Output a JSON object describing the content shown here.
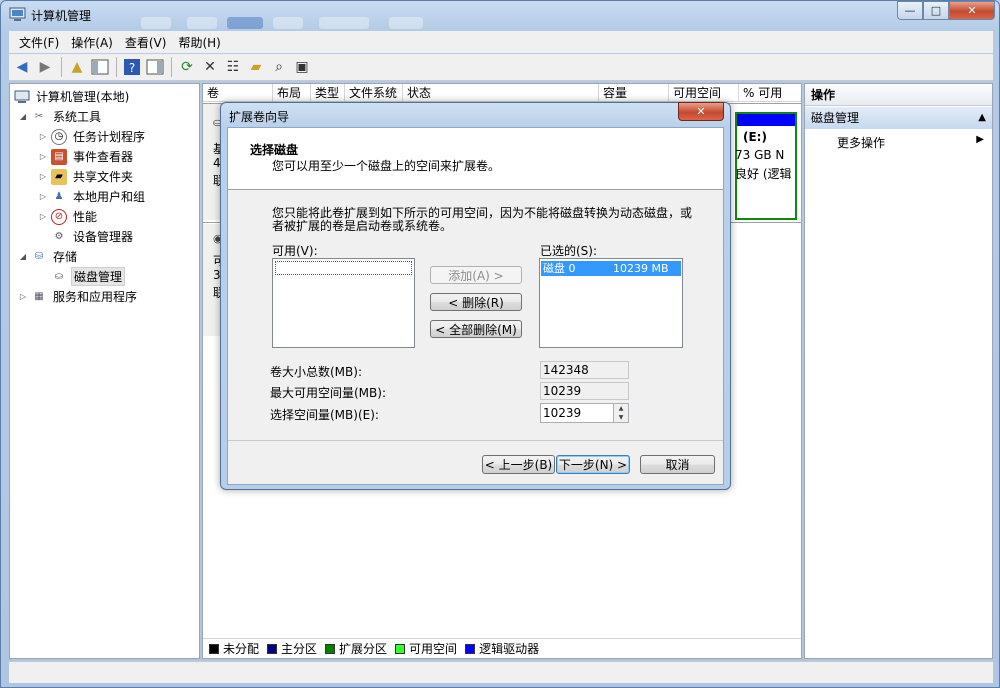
{
  "window": {
    "title": "计算机管理",
    "controls": {
      "minimize": "—",
      "maximize": "□",
      "close": "✕"
    }
  },
  "menu": [
    "文件(F)",
    "操作(A)",
    "查看(V)",
    "帮助(H)"
  ],
  "tree": {
    "root": "计算机管理(本地)",
    "system_tools": "系统工具",
    "task_scheduler": "任务计划程序",
    "event_viewer": "事件查看器",
    "shared_folders": "共享文件夹",
    "local_users": "本地用户和组",
    "performance": "性能",
    "device_manager": "设备管理器",
    "storage": "存储",
    "disk_management": "磁盘管理",
    "services": "服务和应用程序"
  },
  "columns": [
    "卷",
    "布局",
    "类型",
    "文件系统",
    "状态",
    "容量",
    "可用空间",
    "% 可用"
  ],
  "disk_view": {
    "disk0_lines": [
      "基",
      "4",
      "联"
    ],
    "disk1_lines": [
      "可",
      "3",
      "联"
    ],
    "partition_e": {
      "name": "(E:)",
      "size": "73 GB N",
      "status": "良好 (逻辑"
    }
  },
  "legend": [
    {
      "label": "未分配",
      "color": "#000000"
    },
    {
      "label": "主分区",
      "color": "#00007f"
    },
    {
      "label": "扩展分区",
      "color": "#007f00"
    },
    {
      "label": "可用空间",
      "color": "#33ff33"
    },
    {
      "label": "逻辑驱动器",
      "color": "#0000ff"
    }
  ],
  "actions": {
    "header": "操作",
    "section": "磁盘管理",
    "more": "更多操作"
  },
  "wizard": {
    "title": "扩展卷向导",
    "header_title": "选择磁盘",
    "header_subtitle": "您可以用至少一个磁盘上的空间来扩展卷。",
    "description_line1": "您只能将此卷扩展到如下所示的可用空间，因为不能将磁盘转换为动态磁盘，或",
    "description_line2": "者被扩展的卷是启动卷或系统卷。",
    "available_label": "可用(V):",
    "selected_label": "已选的(S):",
    "selected_item": {
      "disk": "磁盘 0",
      "size": "10239 MB"
    },
    "add_button": "添加(A) >",
    "remove_button": "< 删除(R)",
    "remove_all_button": "< 全部删除(M)",
    "total_size_label": "卷大小总数(MB):",
    "total_size_value": "142348",
    "max_space_label": "最大可用空间量(MB):",
    "max_space_value": "10239",
    "select_space_label": "选择空间量(MB)(E):",
    "select_space_value": "10239",
    "back_button": "< 上一步(B)",
    "next_button": "下一步(N) >",
    "cancel_button": "取消"
  },
  "colors": {
    "primary_partition": "#00007f",
    "logical_drive": "#0000ff",
    "extended_partition": "#007f00",
    "selection_highlight": "#3399ff"
  }
}
